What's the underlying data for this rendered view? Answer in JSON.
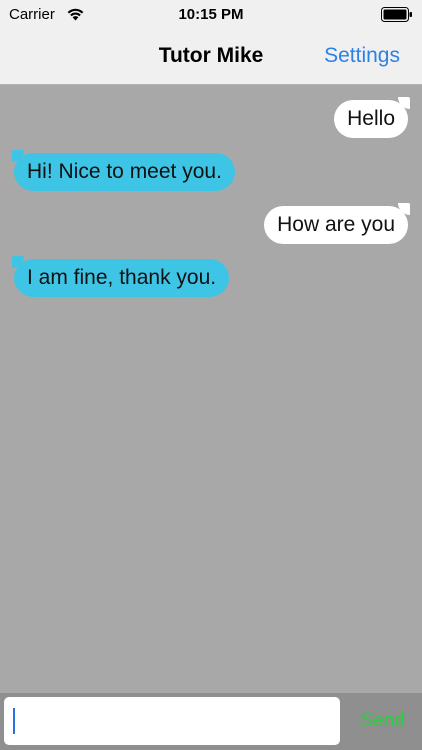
{
  "status_bar": {
    "carrier": "Carrier",
    "time": "10:15 PM"
  },
  "nav": {
    "title": "Tutor Mike",
    "settings_label": "Settings"
  },
  "messages": [
    {
      "text": "Hello",
      "direction": "outgoing"
    },
    {
      "text": "Hi! Nice to meet you.",
      "direction": "incoming"
    },
    {
      "text": "How are you",
      "direction": "outgoing"
    },
    {
      "text": "I am fine, thank you.",
      "direction": "incoming"
    }
  ],
  "composer": {
    "value": "",
    "send_label": "Send"
  },
  "colors": {
    "accent": "#2a82e4",
    "incoming_bubble": "#3ec5e6",
    "outgoing_bubble": "#ffffff",
    "send": "#2ecc40",
    "chat_background": "#a8a8a8"
  }
}
